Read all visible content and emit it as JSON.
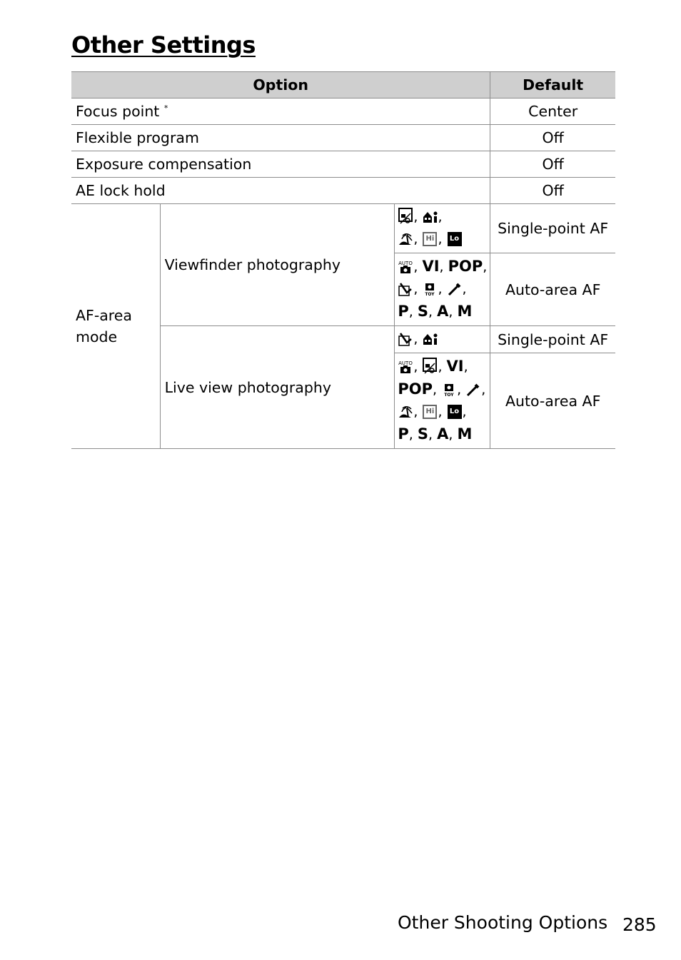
{
  "page": {
    "title": "Other Settings",
    "footer_section": "Other Shooting Options",
    "page_number": "285"
  },
  "table": {
    "headers": {
      "option": "Option",
      "default": "Default"
    },
    "simple_rows": [
      {
        "option": "Focus point",
        "note": "*",
        "default": "Center"
      },
      {
        "option": "Flexible program",
        "default": "Off"
      },
      {
        "option": "Exposure compensation",
        "default": "Off"
      },
      {
        "option": "AE lock hold",
        "default": "Off"
      }
    ],
    "af_area": {
      "label": "AF-area mode",
      "viewfinder": {
        "label": "Viewfinder photography",
        "rows": [
          {
            "modes": [
              "night-portrait",
              "party-indoor",
              "beach-snow",
              "high-key",
              "low-key"
            ],
            "default": "Single-point AF"
          },
          {
            "modes": [
              "auto",
              "VI",
              "POP",
              "photo-illustration",
              "toy-camera",
              "color-sketch-pen",
              "P",
              "S",
              "A",
              "M"
            ],
            "default": "Auto-area AF"
          }
        ]
      },
      "live_view": {
        "label": "Live view photography",
        "rows": [
          {
            "modes": [
              "photo-illustration",
              "party-indoor"
            ],
            "default": "Single-point AF"
          },
          {
            "modes": [
              "auto",
              "night-portrait",
              "VI",
              "POP",
              "toy-camera",
              "color-sketch-pen",
              "beach-snow",
              "high-key",
              "low-key",
              "P",
              "S",
              "A",
              "M"
            ],
            "default": "Auto-area AF"
          }
        ]
      },
      "icon_text": {
        "vi": "VI",
        "pop": "POP",
        "hi": "Hi",
        "lo": "Lo",
        "auto": "AUTO",
        "toy": "TOY",
        "p": "P",
        "s": "S",
        "a": "A",
        "m": "M"
      }
    }
  }
}
